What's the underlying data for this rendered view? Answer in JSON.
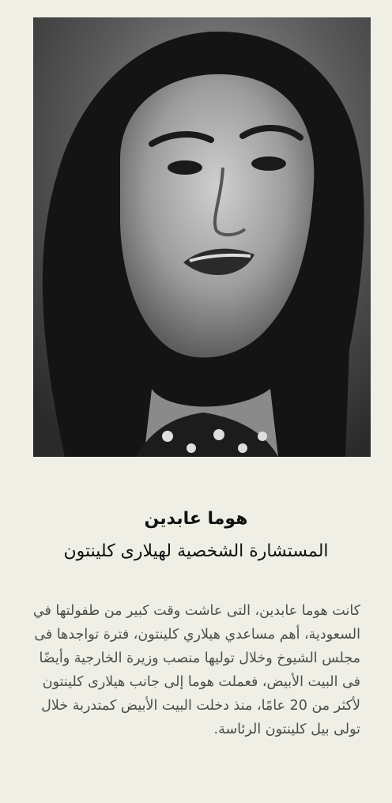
{
  "profile": {
    "name": "هوما عابدين",
    "role": "المستشارة الشخصية لهيلارى كلينتون",
    "bio": "كانت هوما عابدين، التى عاشت وقت كبير من طفولتها في السعودية، أهم مساعدي هيلاري كلينتون، فترة تواجدها فى مجلس الشيوخ وخلال توليها منصب وزيرة الخارجية وأيضًا فى البيت الأبيض، فعملت هوما إلى جانب هيلارى كلينتون لأكثر من 20 عامًا، منذ دخلت البيت الأبيض كمتدربة خلال تولى بيل كلينتون الرئاسة."
  },
  "colors": {
    "background": "#efefe6",
    "heading": "#111111",
    "body_text": "#4d4d4d"
  }
}
